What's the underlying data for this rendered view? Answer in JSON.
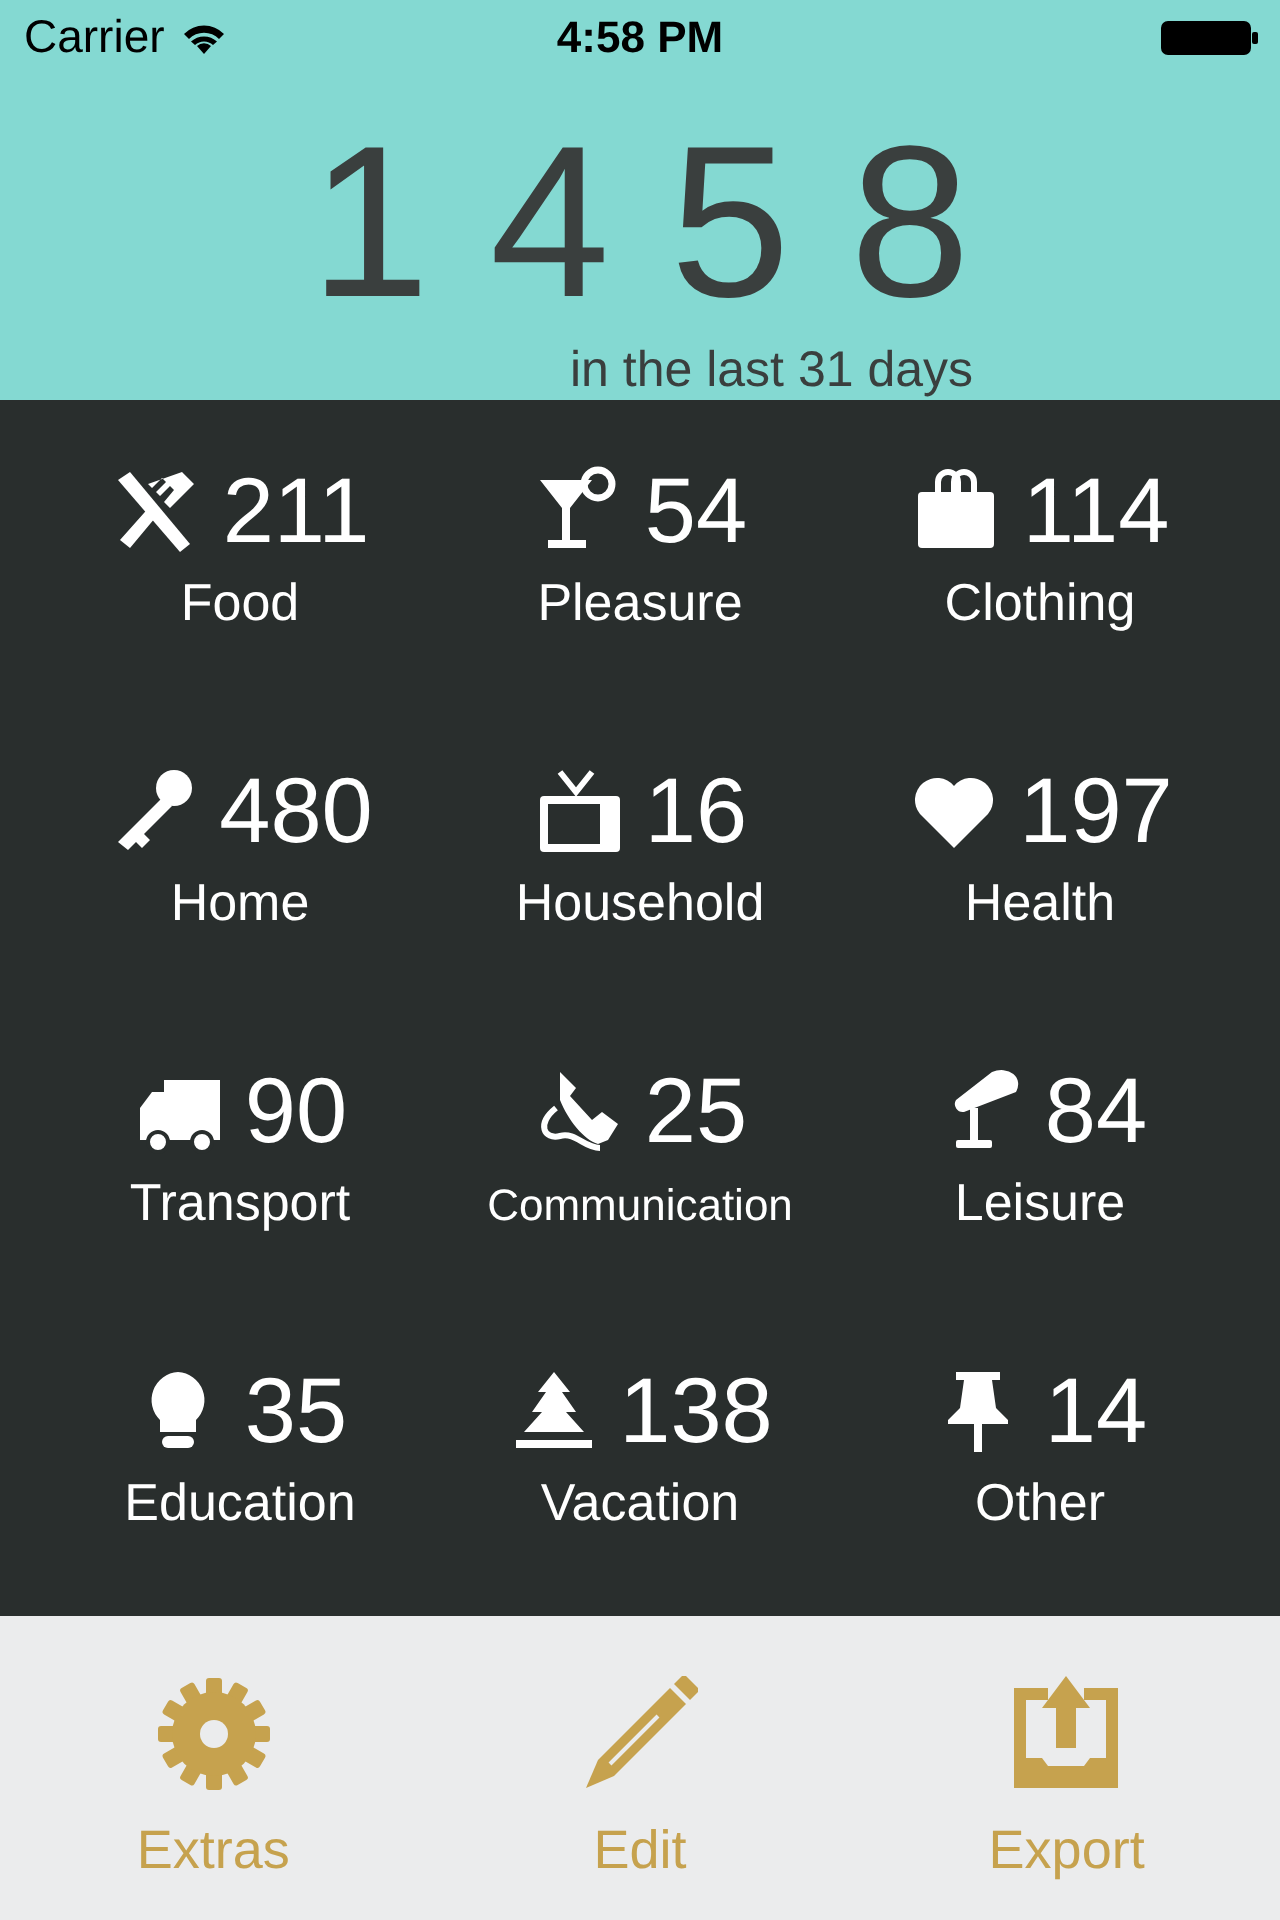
{
  "status_bar": {
    "carrier": "Carrier",
    "time": "4:58 PM"
  },
  "summary": {
    "total": "1458",
    "caption": "in the last 31 days"
  },
  "categories": [
    {
      "name": "Food",
      "count": "211"
    },
    {
      "name": "Pleasure",
      "count": "54"
    },
    {
      "name": "Clothing",
      "count": "114"
    },
    {
      "name": "Home",
      "count": "480"
    },
    {
      "name": "Household",
      "count": "16"
    },
    {
      "name": "Health",
      "count": "197"
    },
    {
      "name": "Transport",
      "count": "90"
    },
    {
      "name": "Communication",
      "count": "25"
    },
    {
      "name": "Leisure",
      "count": "84"
    },
    {
      "name": "Education",
      "count": "35"
    },
    {
      "name": "Vacation",
      "count": "138"
    },
    {
      "name": "Other",
      "count": "14"
    }
  ],
  "toolbar": [
    {
      "label": "Extras"
    },
    {
      "label": "Edit"
    },
    {
      "label": "Export"
    }
  ]
}
